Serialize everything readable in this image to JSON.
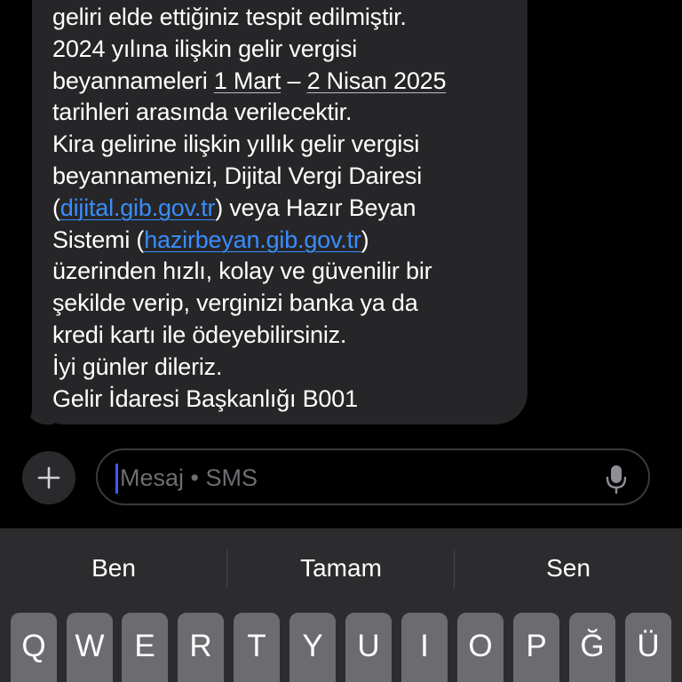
{
  "message": {
    "lines": [
      [
        {
          "t": "geliri elde ettiğiniz tespit edilmiştir."
        }
      ],
      [
        {
          "t": "2024 yılına ilişkin gelir vergisi"
        }
      ],
      [
        {
          "t": "beyannameleri "
        },
        {
          "t": "1 Mart",
          "s": "date"
        },
        {
          "t": " – "
        },
        {
          "t": "2 Nisan 2025",
          "s": "date"
        }
      ],
      [
        {
          "t": "tarihleri arasında verilecektir."
        }
      ],
      [
        {
          "t": "Kira gelirine ilişkin yıllık gelir vergisi"
        }
      ],
      [
        {
          "t": "beyannamenizi, Dijital Vergi Dairesi"
        }
      ],
      [
        {
          "t": "("
        },
        {
          "t": "dijital.gib.gov.tr",
          "s": "link"
        },
        {
          "t": ") veya Hazır Beyan"
        }
      ],
      [
        {
          "t": "Sistemi ("
        },
        {
          "t": "hazirbeyan.gib.gov.tr",
          "s": "link"
        },
        {
          "t": ")"
        }
      ],
      [
        {
          "t": "üzerinden hızlı, kolay ve güvenilir bir"
        }
      ],
      [
        {
          "t": "şekilde verip, verginizi banka ya da"
        }
      ],
      [
        {
          "t": "kredi kartı ile ödeyebilirsiniz."
        }
      ],
      [
        {
          "t": "İyi günler dileriz."
        }
      ],
      [
        {
          "t": "Gelir İdaresi Başkanlığı B001"
        }
      ]
    ]
  },
  "composer": {
    "placeholder": "Mesaj • SMS",
    "add_icon": "plus-icon",
    "mic_icon": "microphone-icon"
  },
  "keyboard": {
    "suggestions": [
      "Ben",
      "Tamam",
      "Sen"
    ],
    "keys": [
      "Q",
      "W",
      "E",
      "R",
      "T",
      "Y",
      "U",
      "I",
      "O",
      "P",
      "Ğ",
      "Ü"
    ]
  },
  "colors": {
    "background": "#000000",
    "bubble": "#262628",
    "link": "#3a8dff",
    "caret": "#3d5cf5",
    "placeholder": "#6d6d72",
    "keyboard": "#2c2c2e",
    "key": "#6c6c70"
  }
}
